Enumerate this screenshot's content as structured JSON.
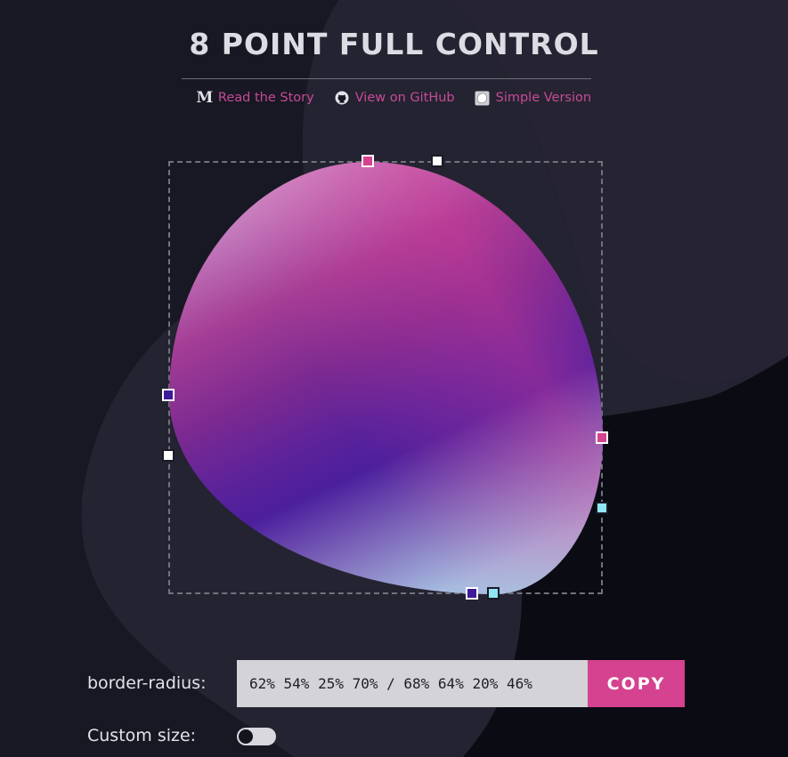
{
  "header": {
    "title": "8 POINT FULL CONTROL",
    "links": [
      {
        "label": "Read the Story",
        "icon": "medium-icon",
        "glyph": "M"
      },
      {
        "label": "View on GitHub",
        "icon": "github-icon"
      },
      {
        "label": "Simple Version",
        "icon": "blob-icon"
      }
    ]
  },
  "editor": {
    "border_radius_label": "border-radius:",
    "border_radius_value": "62% 54% 25% 70% / 68% 64% 20% 46%",
    "copy_label": "COPY",
    "custom_size_label": "Custom size:",
    "custom_size_enabled": false
  },
  "colors": {
    "accent": "#d5428f",
    "background": "#0b0b14",
    "handle_pink": "#d5428f",
    "handle_white": "#ffffff",
    "handle_purple": "#3f1a9a",
    "handle_cyan": "#8fe6f4"
  }
}
